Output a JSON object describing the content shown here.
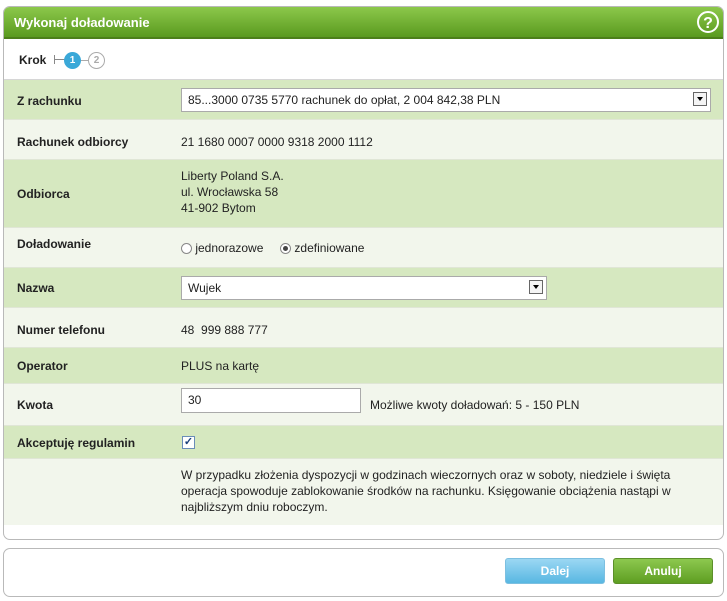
{
  "header": {
    "title": "Wykonaj doładowanie",
    "help_icon": "?"
  },
  "steps": {
    "label": "Krok",
    "step1": "1",
    "step2": "2"
  },
  "rows": {
    "account": {
      "label": "Z rachunku",
      "value": "85...3000 0735 5770 rachunek do opłat, 2 004 842,38 PLN"
    },
    "recipient_account": {
      "label": "Rachunek odbiorcy",
      "value": "21 1680 0007 0000 9318 2000 1112"
    },
    "recipient": {
      "label": "Odbiorca",
      "line1": "Liberty Poland S.A.",
      "line2": "ul. Wrocławska 58",
      "line3": "41-902 Bytom"
    },
    "topup": {
      "label": "Doładowanie",
      "option1": "jednorazowe",
      "option2": "zdefiniowane",
      "selected": "zdefiniowane"
    },
    "name": {
      "label": "Nazwa",
      "value": "Wujek"
    },
    "phone": {
      "label": "Numer telefonu",
      "value": "48  999 888 777"
    },
    "operator": {
      "label": "Operator",
      "value": "PLUS na kartę"
    },
    "amount": {
      "label": "Kwota",
      "value": "30",
      "hint": "Możliwe kwoty doładowań: 5 - 150 PLN"
    },
    "terms": {
      "label": "Akceptuję regulamin",
      "checked": true,
      "check_mark": "✓"
    },
    "note": {
      "line1": "W przypadku złożenia dyspozycji w godzinach wieczornych oraz w soboty, niedziele i święta",
      "line2": "operacja spowoduje zablokowanie środków na rachunku. Księgowanie obciążenia nastąpi w",
      "line3": "najbliższym dniu roboczym."
    }
  },
  "buttons": {
    "next": "Dalej",
    "cancel": "Anuluj"
  },
  "colors": {
    "header_green": "#5a9a1f",
    "row_green": "#d6e8c0",
    "row_light": "#f2f6ec",
    "step_blue": "#3aa8d8"
  }
}
